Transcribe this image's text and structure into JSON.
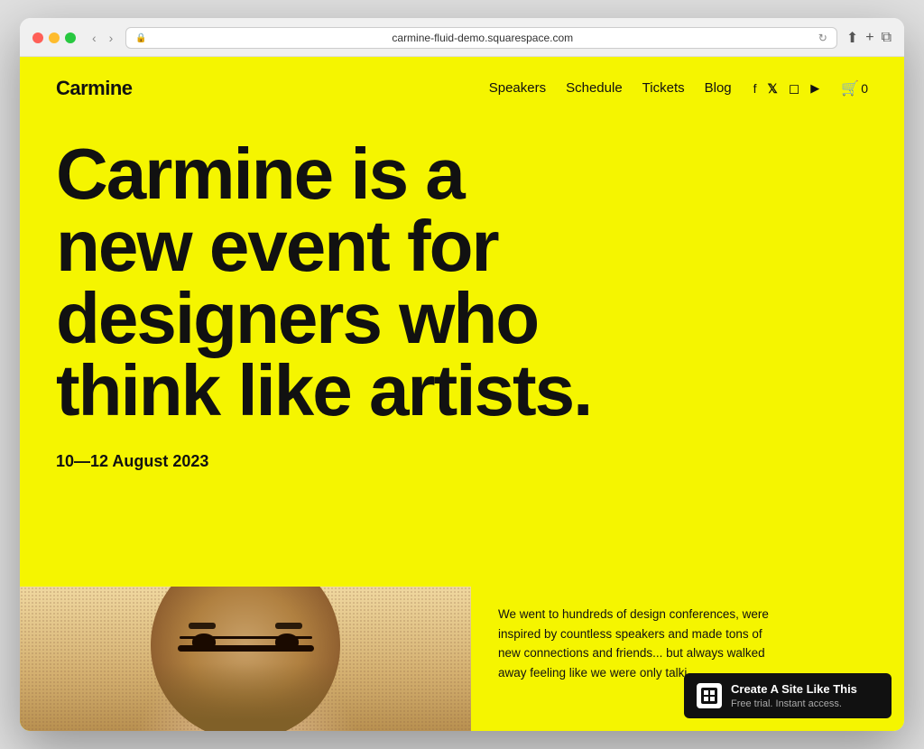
{
  "browser": {
    "url": "carmine-fluid-demo.squarespace.com",
    "back_label": "‹",
    "forward_label": "›",
    "share_label": "⬆",
    "new_tab_label": "+",
    "copy_label": "⧉"
  },
  "site": {
    "logo": "Carmine",
    "nav": {
      "links": [
        {
          "label": "Speakers",
          "href": "#"
        },
        {
          "label": "Schedule",
          "href": "#"
        },
        {
          "label": "Tickets",
          "href": "#"
        },
        {
          "label": "Blog",
          "href": "#"
        }
      ],
      "social": [
        {
          "label": "f",
          "name": "facebook-icon"
        },
        {
          "label": "𝕏",
          "name": "twitter-icon"
        },
        {
          "label": "◻",
          "name": "instagram-icon"
        },
        {
          "label": "▶",
          "name": "youtube-icon"
        }
      ],
      "cart": "0"
    },
    "hero": {
      "headline": "Carmine is a new event for designers who think like artists.",
      "date": "10—12 August 2023"
    },
    "description": "We went to hundreds of design conferences, were inspired by countless speakers and made tons of new connections and friends... but always walked away feeling like we were only talki"
  },
  "squarespace_banner": {
    "title": "Create A Site Like This",
    "subtitle": "Free trial. Instant access.",
    "logo_mark": "◼"
  }
}
